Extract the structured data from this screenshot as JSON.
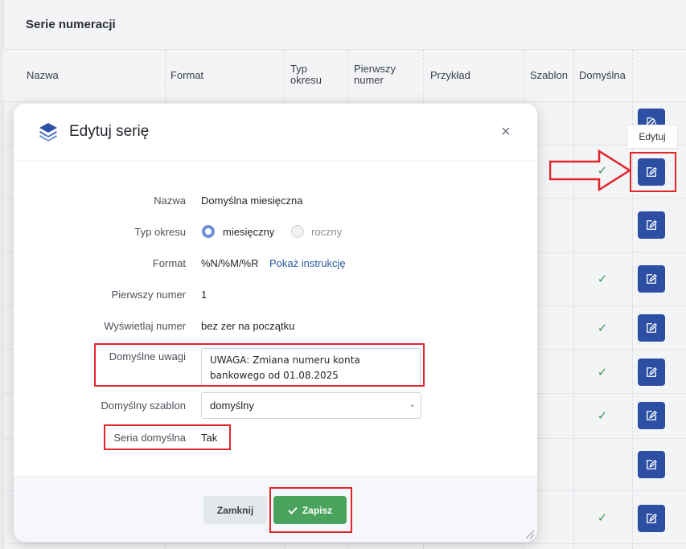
{
  "page": {
    "title": "Serie numeracji",
    "columns": [
      "Nazwa",
      "Format",
      "Typ okresu",
      "Pierwszy numer",
      "Przykład",
      "Szablon",
      "Domyślna"
    ],
    "tooltip": "Edytuj",
    "check_glyph": "✓",
    "edit_icon": "edit-icon"
  },
  "modal": {
    "title": "Edytuj serię",
    "close_glyph": "×",
    "fields": {
      "nazwa_label": "Nazwa",
      "nazwa_value": "Domyślna miesięczna",
      "typ_label": "Typ okresu",
      "typ_option_1": "miesięczny",
      "typ_option_2": "roczny",
      "typ_selected": "miesięczny",
      "format_label": "Format",
      "format_value": "%N/%M/%R",
      "format_link": "Pokaż instrukcję",
      "pierwszy_label": "Pierwszy numer",
      "pierwszy_value": "1",
      "wyswietlaj_label": "Wyświetlaj numer",
      "wyswietlaj_value": "bez zer na początku",
      "uwagi_label": "Domyślne uwagi",
      "uwagi_value": "UWAGA: Zmiana numeru konta bankowego od 01.08.2025",
      "szablon_label": "Domyślny szablon",
      "szablon_value": "domyślny",
      "seria_label": "Seria domyślna",
      "seria_value": "Tak"
    },
    "buttons": {
      "close": "Zamknij",
      "save": "Zapisz"
    }
  },
  "colors": {
    "primary": "#2c4fa3",
    "success": "#49a35d",
    "annotation_red": "#e0262b",
    "link": "#2c5aa0"
  }
}
